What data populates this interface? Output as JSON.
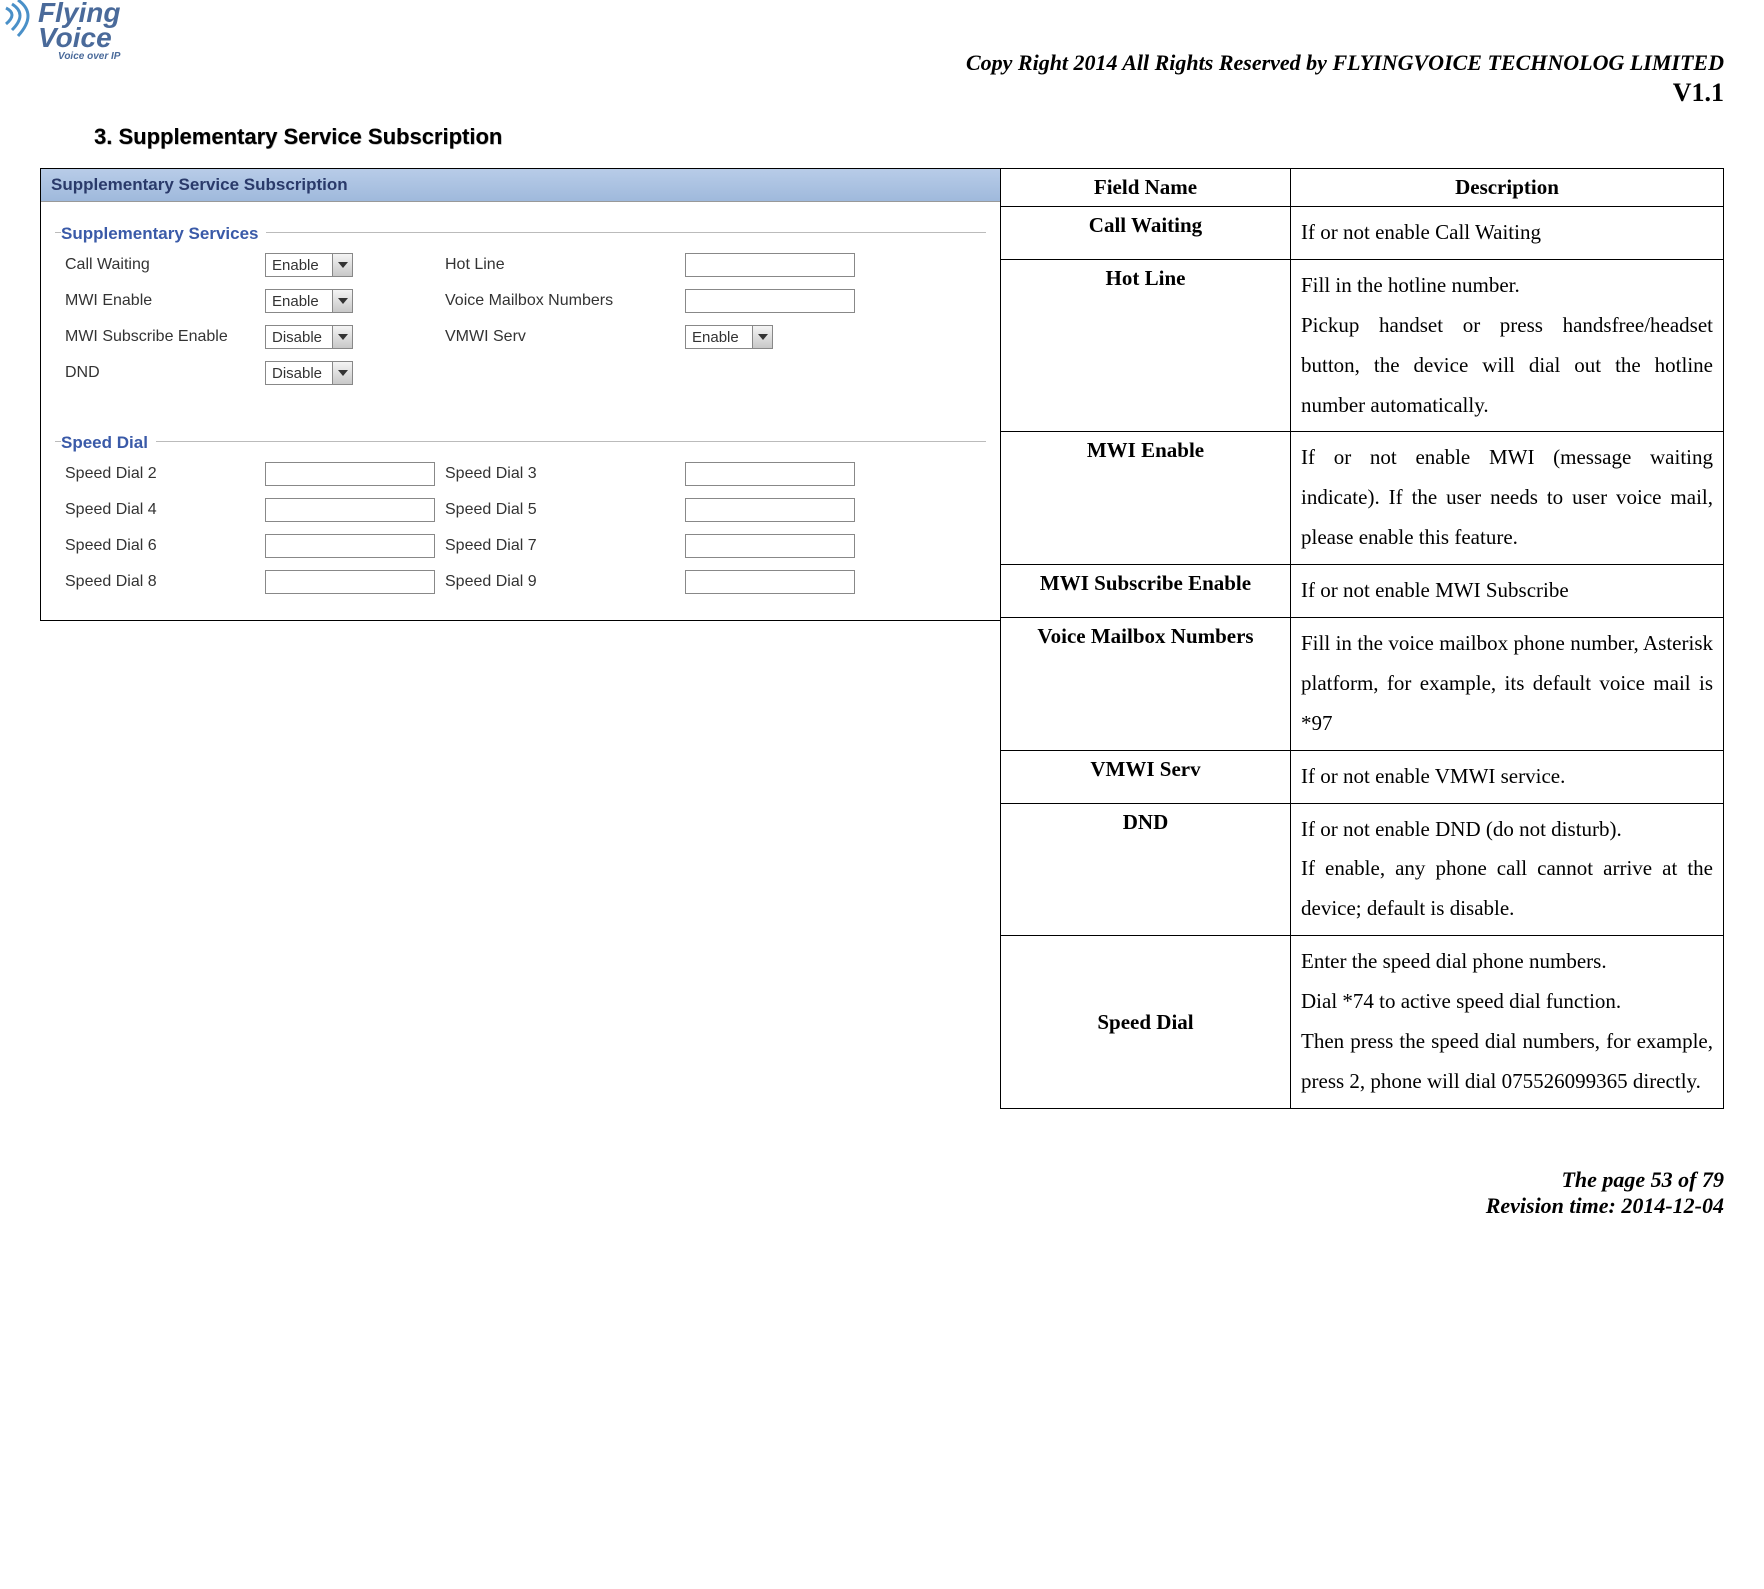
{
  "logo": {
    "line1": "Flying",
    "line2": "Voice",
    "sub": "Voice over IP"
  },
  "header": {
    "copyright": "Copy Right 2014 All Rights Reserved by FLYINGVOICE TECHNOLOG LIMITED",
    "version": "V1.1"
  },
  "section_heading": "3.  Supplementary Service Subscription",
  "screenshot": {
    "title": "Supplementary Service Subscription",
    "sections": {
      "supp": {
        "title": "Supplementary Services",
        "rows": {
          "call_waiting": {
            "label": "Call Waiting",
            "value": "Enable"
          },
          "hot_line": {
            "label": "Hot Line",
            "value": ""
          },
          "mwi_enable": {
            "label": "MWI Enable",
            "value": "Enable"
          },
          "voice_mailbox": {
            "label": "Voice Mailbox Numbers",
            "value": ""
          },
          "mwi_subscribe": {
            "label": "MWI Subscribe Enable",
            "value": "Disable"
          },
          "vmwi_serv": {
            "label": "VMWI Serv",
            "value": "Enable"
          },
          "dnd": {
            "label": "DND",
            "value": "Disable"
          }
        }
      },
      "speed": {
        "title": "Speed Dial",
        "rows": {
          "sd2": {
            "label": "Speed Dial 2"
          },
          "sd3": {
            "label": "Speed Dial 3"
          },
          "sd4": {
            "label": "Speed Dial 4"
          },
          "sd5": {
            "label": "Speed Dial 5"
          },
          "sd6": {
            "label": "Speed Dial 6"
          },
          "sd7": {
            "label": "Speed Dial 7"
          },
          "sd8": {
            "label": "Speed Dial 8"
          },
          "sd9": {
            "label": "Speed Dial 9"
          }
        }
      }
    }
  },
  "table": {
    "header": {
      "field": "Field Name",
      "desc": "Description"
    },
    "rows": [
      {
        "field": "Call Waiting",
        "desc": "If or not enable Call Waiting"
      },
      {
        "field": "Hot Line",
        "desc": "Fill in the hotline number.\nPickup handset or press handsfree/headset button, the device will dial out the hotline number automatically."
      },
      {
        "field": "MWI Enable",
        "desc": "If or not enable MWI (message waiting indicate). If the user needs to user voice mail, please enable this feature."
      },
      {
        "field": "MWI Subscribe Enable",
        "desc": "If or not enable MWI Subscribe"
      },
      {
        "field": "Voice Mailbox Numbers",
        "desc": "Fill in the voice mailbox phone number, Asterisk platform, for example, its default voice mail is *97"
      },
      {
        "field": "VMWI Serv",
        "desc": "If or not enable VMWI service."
      },
      {
        "field": "DND",
        "desc": "If or not enable DND (do not disturb).\nIf enable, any phone call cannot arrive at the device; default is disable."
      },
      {
        "field": "Speed Dial",
        "desc": "Enter the speed dial phone numbers.\nDial *74 to active speed dial function.\nThen press the speed dial numbers, for example, press 2, phone will dial 075526099365 directly."
      }
    ]
  },
  "footer": {
    "page": "The page 53 of 79",
    "revision": "Revision time: 2014-12-04"
  }
}
